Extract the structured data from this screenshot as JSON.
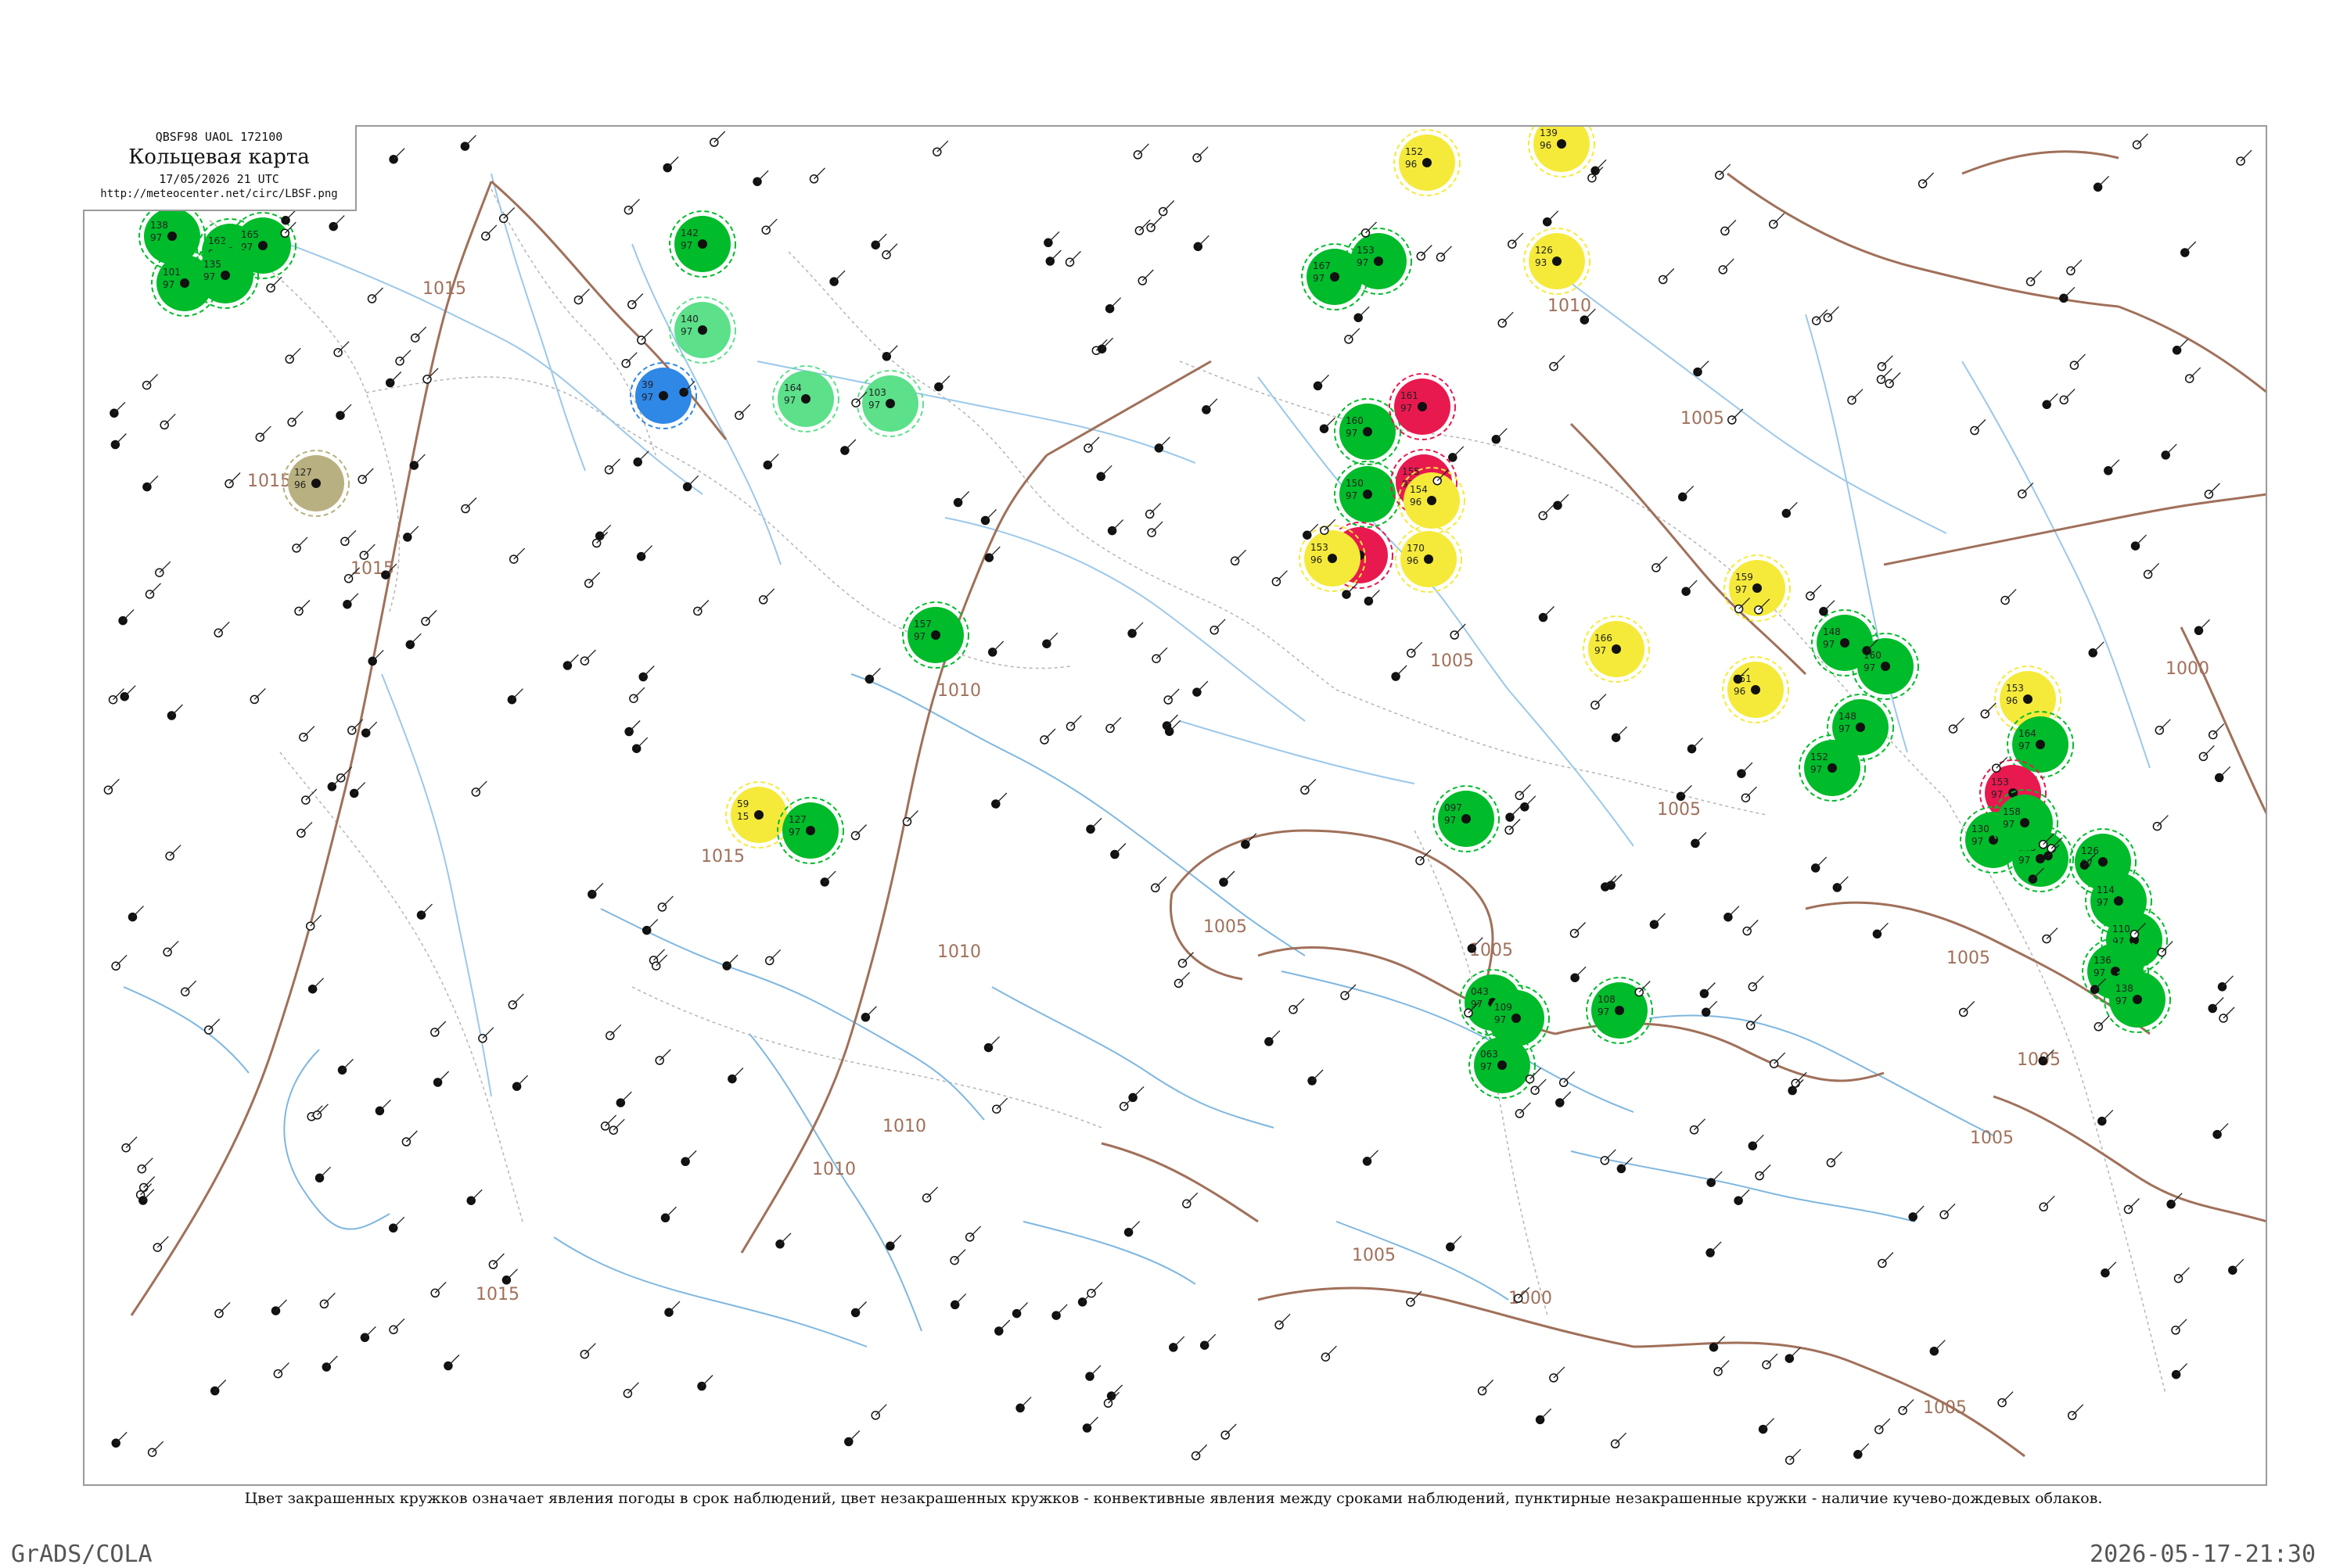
{
  "header": {
    "code_line": "QBSF98 UAOL 172100",
    "title": "Кольцевая карта",
    "date_line": "17/05/2026 21 UTC",
    "url": "http://meteocenter.net/circ/LBSF.png"
  },
  "legend_note": "Цвет закрашенных кружков означает явления погоды в срок наблюдений, цвет незакрашенных кружков - конвективные явления между сроками наблюдений, пунктирные незакрашенные кружки - наличие кучево-дождевых облаков.",
  "footer": {
    "left": "GrADS/COLA",
    "right": "2026-05-17-21:30"
  },
  "colors": {
    "isobar": "#a0705a",
    "water": "#9cc8ea",
    "rain": "#00bb2a",
    "thunderstorm": "#e8194f",
    "haze": "#f5ea3a",
    "shower": "#5ce08a",
    "snow": "#2f87e6",
    "dust": "#b8b080"
  },
  "isobar_labels": [
    "1015",
    "1015",
    "1015",
    "1015",
    "1015",
    "1010",
    "1010",
    "1010",
    "1010",
    "1005",
    "1005",
    "1005",
    "1005",
    "1005",
    "1005",
    "1005",
    "1005",
    "1005",
    "1005",
    "1000",
    "1000",
    "1010"
  ],
  "stations": [
    {
      "obs": "138",
      "val": "97",
      "kind": "rain"
    },
    {
      "obs": "162",
      "val": "97",
      "kind": "rain"
    },
    {
      "obs": "101",
      "val": "97",
      "kind": "rain"
    },
    {
      "obs": "127",
      "val": "96",
      "kind": "dust"
    },
    {
      "obs": "165",
      "val": "97",
      "kind": "rain"
    },
    {
      "obs": "135",
      "val": "97",
      "kind": "rain"
    },
    {
      "obs": "142",
      "val": "97",
      "kind": "rain"
    },
    {
      "obs": "140",
      "val": "97",
      "kind": "shower"
    },
    {
      "obs": "164",
      "val": "97",
      "kind": "shower"
    },
    {
      "obs": "103",
      "val": "97",
      "kind": "shower"
    },
    {
      "obs": "39",
      "val": "97",
      "kind": "snow"
    },
    {
      "obs": "59",
      "val": "15",
      "kind": "haze"
    },
    {
      "obs": "127",
      "val": "97",
      "kind": "rain"
    },
    {
      "obs": "157",
      "val": "97",
      "kind": "rain"
    },
    {
      "obs": "167",
      "val": "97",
      "kind": "rain"
    },
    {
      "obs": "153",
      "val": "97",
      "kind": "rain"
    },
    {
      "obs": "160",
      "val": "97",
      "kind": "rain"
    },
    {
      "obs": "150",
      "val": "97",
      "kind": "rain"
    },
    {
      "obs": "166",
      "val": "97",
      "kind": "thunderstorm"
    },
    {
      "obs": "161",
      "val": "97",
      "kind": "thunderstorm"
    },
    {
      "obs": "155",
      "val": "97",
      "kind": "thunderstorm"
    },
    {
      "obs": "153",
      "val": "96",
      "kind": "haze"
    },
    {
      "obs": "154",
      "val": "96",
      "kind": "haze"
    },
    {
      "obs": "170",
      "val": "96",
      "kind": "haze"
    },
    {
      "obs": "152",
      "val": "96",
      "kind": "haze"
    },
    {
      "obs": "126",
      "val": "93",
      "kind": "haze"
    },
    {
      "obs": "139",
      "val": "96",
      "kind": "haze"
    },
    {
      "obs": "166",
      "val": "97",
      "kind": "haze"
    },
    {
      "obs": "151",
      "val": "96",
      "kind": "haze"
    },
    {
      "obs": "159",
      "val": "97",
      "kind": "haze"
    },
    {
      "obs": "153",
      "val": "96",
      "kind": "haze"
    },
    {
      "obs": "148",
      "val": "97",
      "kind": "rain"
    },
    {
      "obs": "160",
      "val": "97",
      "kind": "rain"
    },
    {
      "obs": "148",
      "val": "97",
      "kind": "rain"
    },
    {
      "obs": "152",
      "val": "97",
      "kind": "rain"
    },
    {
      "obs": "164",
      "val": "97",
      "kind": "rain"
    },
    {
      "obs": "153",
      "val": "97",
      "kind": "thunderstorm"
    },
    {
      "obs": "130",
      "val": "97",
      "kind": "rain"
    },
    {
      "obs": "123",
      "val": "97",
      "kind": "rain"
    },
    {
      "obs": "158",
      "val": "97",
      "kind": "rain"
    },
    {
      "obs": "126",
      "val": "97",
      "kind": "rain"
    },
    {
      "obs": "114",
      "val": "97",
      "kind": "rain"
    },
    {
      "obs": "110",
      "val": "97",
      "kind": "rain"
    },
    {
      "obs": "136",
      "val": "97",
      "kind": "rain"
    },
    {
      "obs": "138",
      "val": "97",
      "kind": "rain"
    },
    {
      "obs": "097",
      "val": "97",
      "kind": "rain"
    },
    {
      "obs": "043",
      "val": "97",
      "kind": "rain"
    },
    {
      "obs": "109",
      "val": "97",
      "kind": "rain"
    },
    {
      "obs": "063",
      "val": "97",
      "kind": "rain"
    },
    {
      "obs": "108",
      "val": "97",
      "kind": "rain"
    }
  ]
}
